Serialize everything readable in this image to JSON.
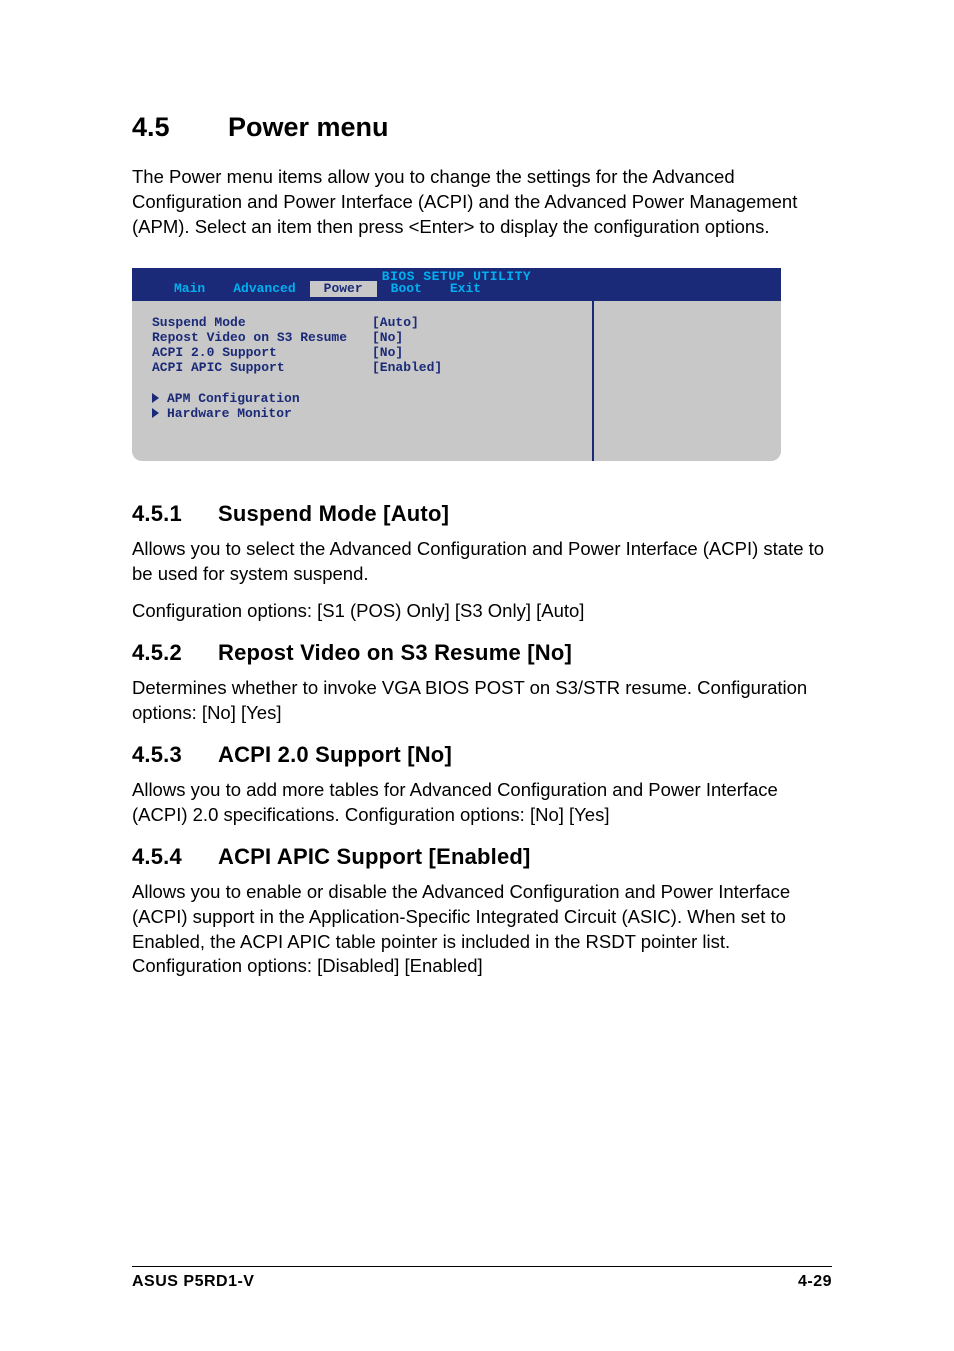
{
  "section": {
    "number": "4.5",
    "title": "Power menu"
  },
  "intro": "The Power menu items allow you to change the settings for the Advanced Configuration and Power Interface (ACPI) and the Advanced Power Management (APM). Select an item then press <Enter> to display the configuration options.",
  "bios": {
    "title": "BIOS SETUP UTILITY",
    "tabs": [
      "Main",
      "Advanced",
      "Power",
      "Boot",
      "Exit"
    ],
    "active_tab_index": 2,
    "options": [
      {
        "label": "Suspend Mode",
        "value": "[Auto]"
      },
      {
        "label": "Repost Video on S3 Resume",
        "value": "[No]"
      },
      {
        "label": "ACPI 2.0 Support",
        "value": "[No]"
      },
      {
        "label": "ACPI APIC Support",
        "value": "[Enabled]"
      }
    ],
    "submenus": [
      "APM Configuration",
      "Hardware Monitor"
    ]
  },
  "subsections": [
    {
      "num": "4.5.1",
      "title": "Suspend Mode [Auto]",
      "paragraphs": [
        "Allows you to select the Advanced Configuration and Power Interface (ACPI) state to be used for system suspend.",
        "Configuration options: [S1 (POS) Only] [S3 Only] [Auto]"
      ]
    },
    {
      "num": "4.5.2",
      "title": "Repost Video on S3 Resume [No]",
      "paragraphs": [
        "Determines whether to invoke VGA BIOS POST on S3/STR resume. Configuration options: [No] [Yes]"
      ]
    },
    {
      "num": "4.5.3",
      "title": "ACPI 2.0 Support [No]",
      "paragraphs": [
        "Allows you to add more tables for Advanced Configuration and Power Interface (ACPI) 2.0 specifications. Configuration options: [No] [Yes]"
      ]
    },
    {
      "num": "4.5.4",
      "title": "ACPI APIC Support [Enabled]",
      "paragraphs": [
        "Allows you to enable or disable the Advanced Configuration and Power Interface (ACPI) support in the Application-Specific Integrated Circuit (ASIC). When set to Enabled, the ACPI APIC table pointer is included in the RSDT pointer list. Configuration options: [Disabled] [Enabled]"
      ]
    }
  ],
  "footer": {
    "left": "ASUS P5RD1-V",
    "right": "4-29"
  }
}
